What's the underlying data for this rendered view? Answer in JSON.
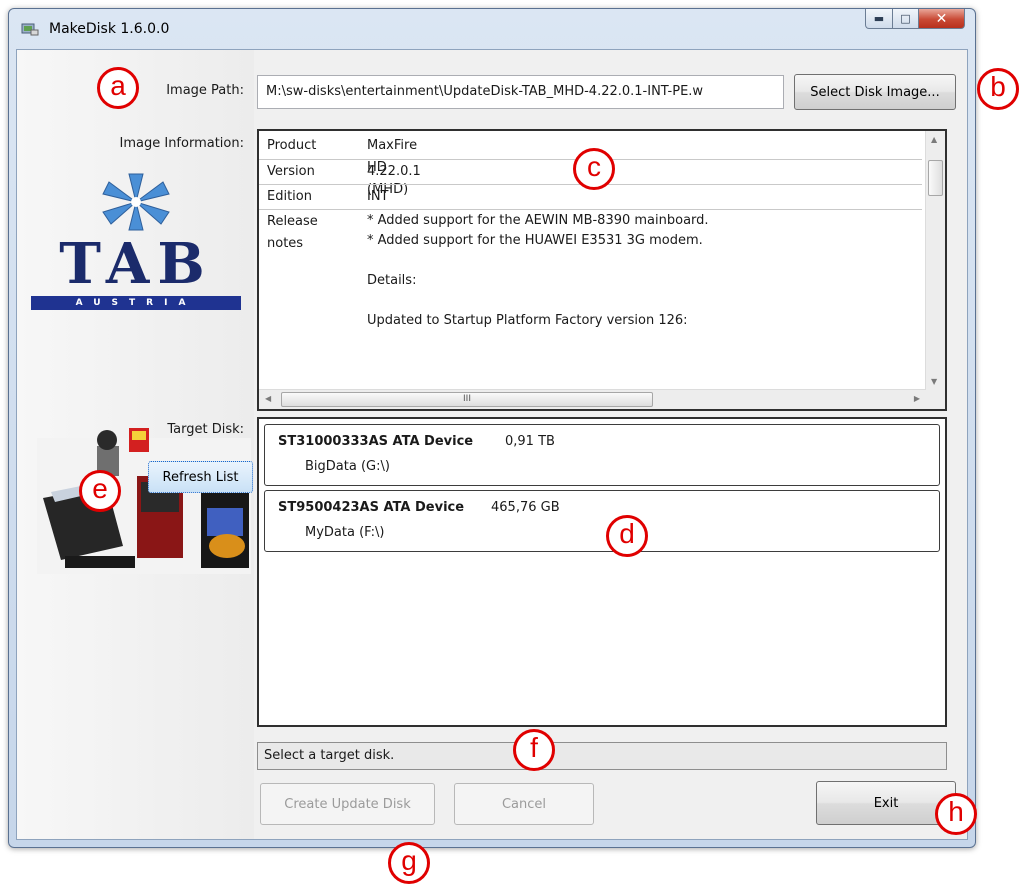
{
  "window": {
    "title": "MakeDisk 1.6.0.0"
  },
  "labels": {
    "image_path": "Image Path:",
    "image_information": "Image Information:",
    "target_disk": "Target Disk:"
  },
  "image_path": {
    "value": "M:\\sw-disks\\entertainment\\UpdateDisk-TAB_MHD-4.22.0.1-INT-PE.w",
    "button": "Select Disk Image..."
  },
  "logo": {
    "word": "TAB",
    "band": "AUSTRIA"
  },
  "info": {
    "rows": [
      {
        "key": "Product",
        "value": "MaxFire HD (MHD)"
      },
      {
        "key": "Version",
        "value": "4.22.0.1"
      },
      {
        "key": "Edition",
        "value": "INT"
      }
    ],
    "notes_key": "Release notes",
    "notes": [
      "* Added support for the AEWIN MB-8390 mainboard.",
      "* Added support for the HUAWEI E3531 3G modem.",
      "",
      "Details:",
      "",
      "Updated to Startup Platform Factory version 126:"
    ],
    "hscroll_grip": "III"
  },
  "refresh_button": "Refresh List",
  "disks": [
    {
      "name": "ST31000333AS ATA Device",
      "size": "0,91 TB",
      "volume": "BigData (G:\\)"
    },
    {
      "name": "ST9500423AS ATA Device",
      "size": "465,76 GB",
      "volume": "MyData (F:\\)"
    }
  ],
  "status": "Select a target disk.",
  "buttons": {
    "create": "Create Update Disk",
    "cancel": "Cancel",
    "exit": "Exit"
  },
  "annotations": {
    "a": "a",
    "b": "b",
    "c": "c",
    "d": "d",
    "e": "e",
    "f": "f",
    "g": "g",
    "h": "h"
  },
  "colors": {
    "annotation": "#e00000",
    "brand_navy": "#1b2b6b",
    "brand_band": "#1f3391",
    "brand_star": "#4a8fd6"
  }
}
